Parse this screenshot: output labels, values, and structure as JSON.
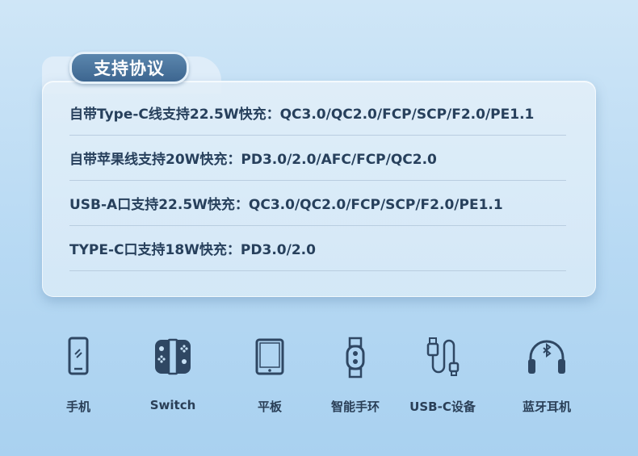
{
  "header": {
    "title": "支持协议"
  },
  "protocols": [
    "自带Type-C线支持22.5W快充：QC3.0/QC2.0/FCP/SCP/F2.0/PE1.1",
    "自带苹果线支持20W快充：PD3.0/2.0/AFC/FCP/QC2.0",
    "USB-A口支持22.5W快充：QC3.0/QC2.0/FCP/SCP/F2.0/PE1.1",
    "TYPE-C口支持18W快充：PD3.0/2.0"
  ],
  "devices": [
    {
      "label": "手机",
      "icon": "phone-icon"
    },
    {
      "label": "Switch",
      "icon": "switch-console-icon"
    },
    {
      "label": "平板",
      "icon": "tablet-icon"
    },
    {
      "label": "智能手环",
      "icon": "smart-band-icon"
    },
    {
      "label": "USB-C设备",
      "icon": "usb-c-cable-icon"
    },
    {
      "label": "蓝牙耳机",
      "icon": "bluetooth-headphones-icon"
    }
  ],
  "colors": {
    "icon": "#2f4763",
    "badge": "#4a739b",
    "text": "#27405c"
  }
}
